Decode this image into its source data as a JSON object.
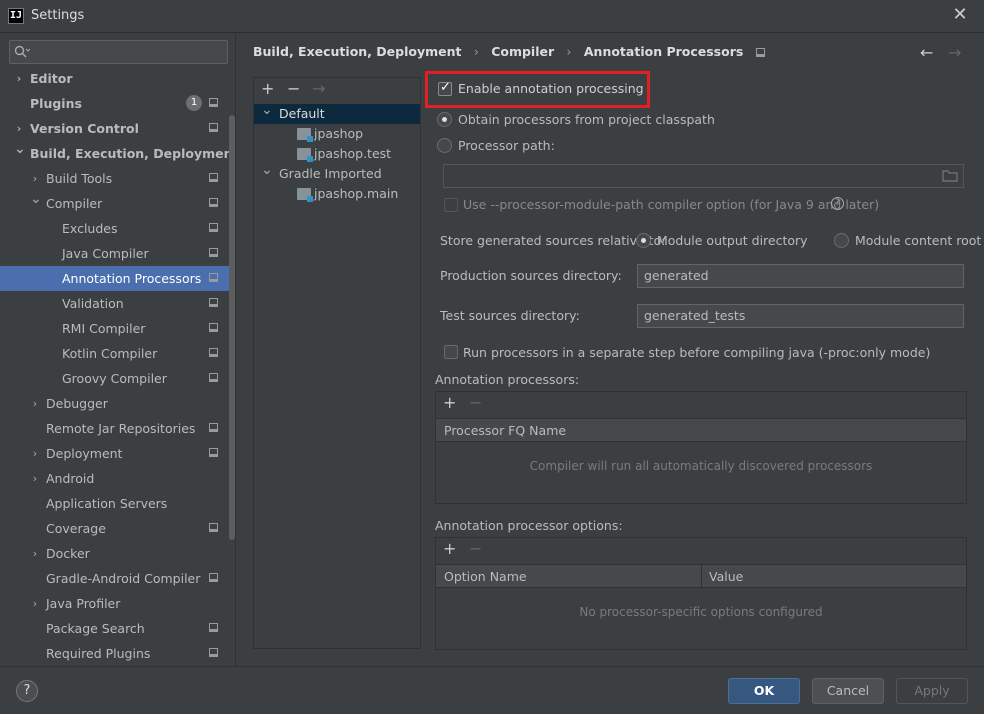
{
  "window": {
    "title": "Settings",
    "app_icon": "IJ",
    "close_icon": "close-icon"
  },
  "sidebar": {
    "search_placeholder": "",
    "items": [
      {
        "label": "Editor",
        "bold": true,
        "chevron": "right",
        "depth": 0
      },
      {
        "label": "Plugins",
        "bold": true,
        "chevron": "",
        "depth": 0,
        "badge": "1"
      },
      {
        "label": "Version Control",
        "bold": true,
        "chevron": "right",
        "depth": 0
      },
      {
        "label": "Build, Execution, Deployment",
        "bold": true,
        "chevron": "down",
        "depth": 0
      },
      {
        "label": "Build Tools",
        "bold": false,
        "chevron": "right",
        "depth": 1
      },
      {
        "label": "Compiler",
        "bold": false,
        "chevron": "down",
        "depth": 1
      },
      {
        "label": "Excludes",
        "bold": false,
        "chevron": "",
        "depth": 2
      },
      {
        "label": "Java Compiler",
        "bold": false,
        "chevron": "",
        "depth": 2
      },
      {
        "label": "Annotation Processors",
        "bold": false,
        "chevron": "",
        "depth": 2,
        "selected": true
      },
      {
        "label": "Validation",
        "bold": false,
        "chevron": "",
        "depth": 2
      },
      {
        "label": "RMI Compiler",
        "bold": false,
        "chevron": "",
        "depth": 2
      },
      {
        "label": "Kotlin Compiler",
        "bold": false,
        "chevron": "",
        "depth": 2
      },
      {
        "label": "Groovy Compiler",
        "bold": false,
        "chevron": "",
        "depth": 2
      },
      {
        "label": "Debugger",
        "bold": false,
        "chevron": "right",
        "depth": 1
      },
      {
        "label": "Remote Jar Repositories",
        "bold": false,
        "chevron": "",
        "depth": 1
      },
      {
        "label": "Deployment",
        "bold": false,
        "chevron": "right",
        "depth": 1
      },
      {
        "label": "Android",
        "bold": false,
        "chevron": "right",
        "depth": 1
      },
      {
        "label": "Application Servers",
        "bold": false,
        "chevron": "",
        "depth": 1
      },
      {
        "label": "Coverage",
        "bold": false,
        "chevron": "",
        "depth": 1
      },
      {
        "label": "Docker",
        "bold": false,
        "chevron": "right",
        "depth": 1
      },
      {
        "label": "Gradle-Android Compiler",
        "bold": false,
        "chevron": "",
        "depth": 1
      },
      {
        "label": "Java Profiler",
        "bold": false,
        "chevron": "right",
        "depth": 1
      },
      {
        "label": "Package Search",
        "bold": false,
        "chevron": "",
        "depth": 1
      },
      {
        "label": "Required Plugins",
        "bold": false,
        "chevron": "",
        "depth": 1
      }
    ],
    "project_icon_rows": [
      false,
      true,
      true,
      false,
      true,
      true,
      true,
      true,
      true,
      true,
      true,
      true,
      true,
      false,
      true,
      true,
      false,
      false,
      true,
      false,
      true,
      false,
      true,
      true
    ]
  },
  "breadcrumb": {
    "items": [
      "Build, Execution, Deployment",
      "Compiler",
      "Annotation Processors"
    ],
    "separator": "›",
    "back_icon": "arrow-left-icon",
    "forward_icon": "arrow-right-icon"
  },
  "modules": {
    "toolbar": {
      "add": "+",
      "remove": "−",
      "move": "→"
    },
    "tree": [
      {
        "label": "Default",
        "chevron": "down",
        "depth": 0,
        "selected": true,
        "folder": false
      },
      {
        "label": "jpashop",
        "chevron": "",
        "depth": 1,
        "folder": true
      },
      {
        "label": "jpashop.test",
        "chevron": "",
        "depth": 1,
        "folder": true
      },
      {
        "label": "Gradle Imported",
        "chevron": "down",
        "depth": 0,
        "folder": false
      },
      {
        "label": "jpashop.main",
        "chevron": "",
        "depth": 1,
        "folder": true
      }
    ]
  },
  "settings": {
    "enable_processing": {
      "label": "Enable annotation processing",
      "checked": true
    },
    "obtain_classpath": {
      "label": "Obtain processors from project classpath",
      "selected": true
    },
    "processor_path": {
      "label": "Processor path:",
      "selected": false,
      "value": ""
    },
    "module_path": {
      "label": "Use --processor-module-path compiler option (for Java 9 and later)",
      "checked": false,
      "enabled": false
    },
    "store_label": "Store generated sources relative to:",
    "module_output": {
      "label": "Module output directory",
      "selected": true
    },
    "module_content": {
      "label": "Module content root",
      "selected": false
    },
    "production_label": "Production sources directory:",
    "production_value": "generated",
    "test_label": "Test sources directory:",
    "test_value": "generated_tests",
    "separate_step": {
      "label": "Run processors in a separate step before compiling java (-proc:only mode)",
      "checked": false
    }
  },
  "processors_table": {
    "title": "Annotation processors:",
    "add": "+",
    "remove": "−",
    "columns": [
      "Processor FQ Name"
    ],
    "empty_text": "Compiler will run all automatically discovered processors"
  },
  "options_table": {
    "title": "Annotation processor options:",
    "add": "+",
    "remove": "−",
    "columns": [
      "Option Name",
      "Value"
    ],
    "empty_text": "No processor-specific options configured"
  },
  "footer": {
    "help": "?",
    "ok": "OK",
    "cancel": "Cancel",
    "apply": "Apply"
  },
  "colors": {
    "selection": "#4b6eaf",
    "highlight_box": "#e31e24",
    "primary_button": "#365880"
  }
}
